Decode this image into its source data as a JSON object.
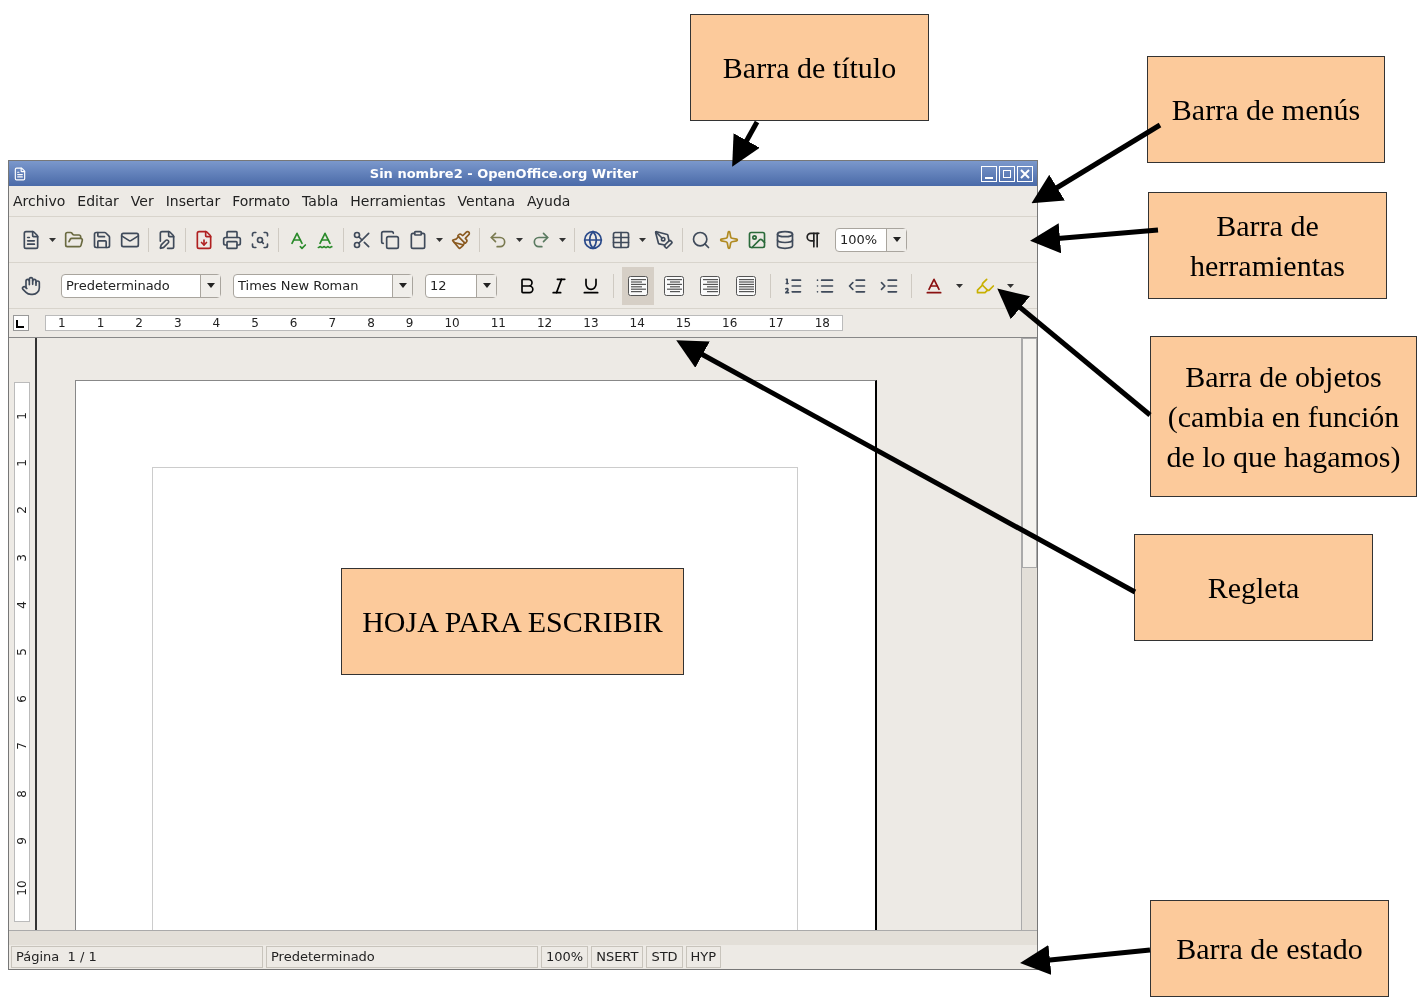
{
  "window": {
    "title": "Sin nombre2 - OpenOffice.org Writer"
  },
  "menu": [
    "Archivo",
    "Editar",
    "Ver",
    "Insertar",
    "Formato",
    "Tabla",
    "Herramientas",
    "Ventana",
    "Ayuda"
  ],
  "toolbar": {
    "zoom": "100%"
  },
  "formatting": {
    "style": "Predeterminado",
    "font": "Times New Roman",
    "size": "12",
    "alignment": [
      {
        "kind": "left",
        "selected": true
      },
      {
        "kind": "center",
        "selected": false
      },
      {
        "kind": "right",
        "selected": false
      },
      {
        "kind": "justify",
        "selected": false
      }
    ]
  },
  "ruler": {
    "horizontal": [
      "1",
      "1",
      "2",
      "3",
      "4",
      "5",
      "6",
      "7",
      "8",
      "9",
      "10",
      "11",
      "12",
      "13",
      "14",
      "15",
      "16",
      "17",
      "18"
    ],
    "vertical": [
      "1",
      "1",
      "2",
      "3",
      "4",
      "5",
      "6",
      "7",
      "8",
      "9",
      "10"
    ]
  },
  "document": {
    "label": "HOJA PARA ESCRIBIR"
  },
  "status_bar": [
    "Página  1 / 1",
    "Predeterminado",
    "100%",
    "NSERT",
    "STD",
    "HYP"
  ],
  "callouts": [
    "Barra de título",
    "Barra de menús",
    "Barra de herramientas",
    "Barra de objetos (cambia en función de lo que hagamos)",
    "Regleta",
    "Barra de estado"
  ]
}
